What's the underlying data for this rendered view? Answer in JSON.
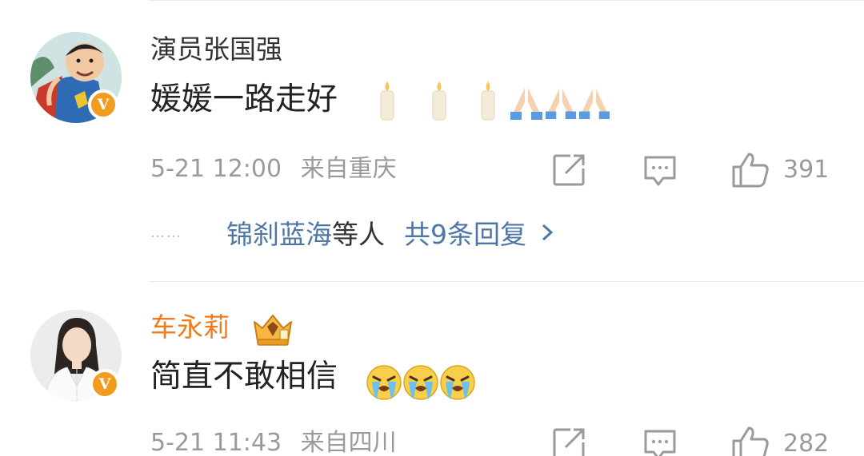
{
  "comments": [
    {
      "username": "演员张国强",
      "badge": "V",
      "text": "媛媛一路走好",
      "emojis": [
        "candle",
        "candle",
        "candle",
        "pray",
        "pray",
        "pray"
      ],
      "time": "5-21 12:00",
      "location": "来自重庆",
      "likes": "391",
      "replies": {
        "dots": "……",
        "names": "锦刹蓝海",
        "suffix": "等人",
        "total": "共9条回复"
      }
    },
    {
      "username": "车永莉",
      "badge": "V",
      "text": "简直不敢相信",
      "emojis": [
        "loudly-crying",
        "loudly-crying",
        "loudly-crying"
      ],
      "time": "5-21 11:43",
      "location": "来自四川",
      "likes": "282"
    }
  ],
  "colors": {
    "vip_orange": "#f29c1f",
    "vip_name": "#f07b1d",
    "link_blue": "#4d76a7",
    "meta_gray": "#9a9a9a"
  }
}
